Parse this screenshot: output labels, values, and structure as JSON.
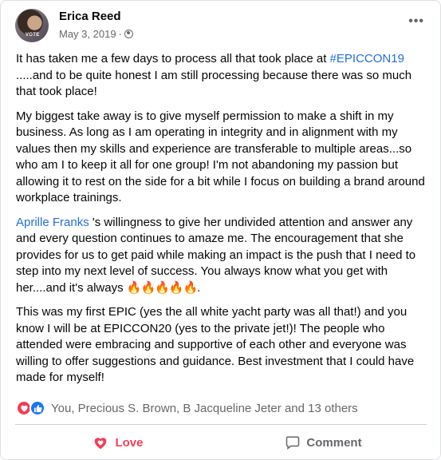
{
  "post": {
    "author": "Erica Reed",
    "date": "May 3, 2019",
    "separator": "·",
    "avatar_tag": "VOTE",
    "more_label": "•••"
  },
  "content": {
    "p1_text_a": "It has taken me a few days to process all that took place at ",
    "p1_hashtag": "#EPICCON19",
    "p1_text_b": " .....and to be quite honest I am still processing because there was so much that took place!",
    "p2": "My biggest take away is to give myself permission to make a shift in my business.  As long as I am operating in integrity and in alignment with my values then my skills and experience are transferable to multiple areas...so who am I to keep it all for one group!  I'm not abandoning my passion but allowing it to rest on the side for a bit while I focus on building a brand around workplace trainings.",
    "p3_mention": "Aprille Franks",
    "p3_text": " 's willingness to give her undivided attention and answer any and every question continues to amaze me.  The encouragement that she provides for us to get paid while making an impact is the push that I need to step into my next level of success.  You always know what you get with her....and it's always ",
    "p3_emoji": "🔥🔥🔥🔥🔥",
    "p3_end": ".",
    "p4": "This was my first EPIC (yes the all white yacht party was all that!) and you know I will be at EPICCON20 (yes to the private jet!)!  The people who attended were embracing and supportive of each other and everyone was willing to offer suggestions and guidance.  Best investment that I could have made for myself!"
  },
  "reactions": {
    "summary": "You, Precious S. Brown, B Jacqueline Jeter and 13 others",
    "icons": [
      "heart-icon",
      "like-icon"
    ],
    "colors": {
      "love": "#f33e58",
      "like": "#1877f2"
    }
  },
  "actions": {
    "love_label": "Love",
    "comment_label": "Comment"
  },
  "colors": {
    "link": "#216fdb",
    "secondary_text": "#65676b"
  }
}
